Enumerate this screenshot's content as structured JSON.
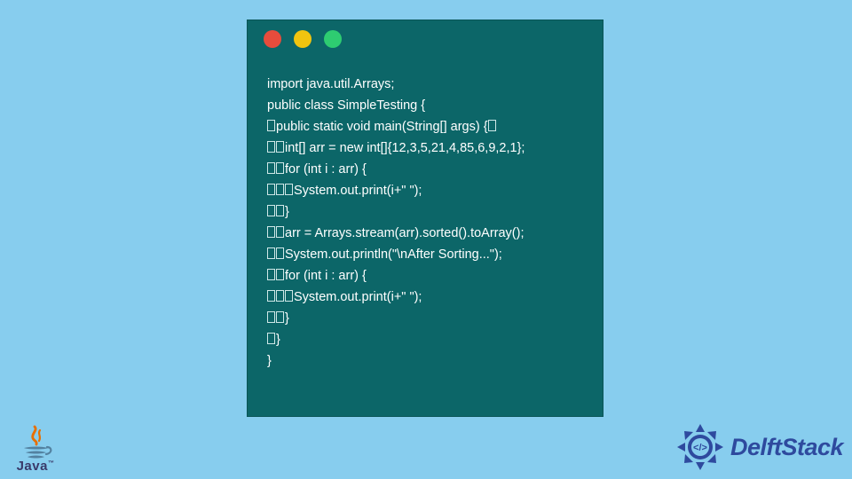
{
  "window": {
    "dots": [
      "red",
      "yellow",
      "green"
    ]
  },
  "code": {
    "lines": [
      {
        "indent": 0,
        "text": "import java.util.Arrays;"
      },
      {
        "indent": 0,
        "text": ""
      },
      {
        "indent": 0,
        "text": "public class SimpleTesting {"
      },
      {
        "indent": 1,
        "text": "public static void main(String[] args) {",
        "trail_box": true
      },
      {
        "indent": 2,
        "text": "int[] arr = new int[]{12,3,5,21,4,85,6,9,2,1};"
      },
      {
        "indent": 2,
        "text": "for (int i : arr) {"
      },
      {
        "indent": 3,
        "text": "System.out.print(i+\" \");"
      },
      {
        "indent": 2,
        "text": "}"
      },
      {
        "indent": 2,
        "text": "arr = Arrays.stream(arr).sorted().toArray();"
      },
      {
        "indent": 2,
        "text": "System.out.println(\"\\nAfter Sorting...\");"
      },
      {
        "indent": 2,
        "text": "for (int i : arr) {"
      },
      {
        "indent": 3,
        "text": "System.out.print(i+\" \");"
      },
      {
        "indent": 2,
        "text": "}"
      },
      {
        "indent": 1,
        "text": "}"
      },
      {
        "indent": 0,
        "text": "}"
      }
    ]
  },
  "logos": {
    "java_label": "Java",
    "delft_label": "DelftStack"
  },
  "colors": {
    "background": "#87cdee",
    "window": "#0c6668",
    "dot_red": "#e74c3c",
    "dot_yellow": "#f1c40f",
    "dot_green": "#2ecc71",
    "delft_blue": "#2e4a9e",
    "java_orange": "#e76f00"
  }
}
